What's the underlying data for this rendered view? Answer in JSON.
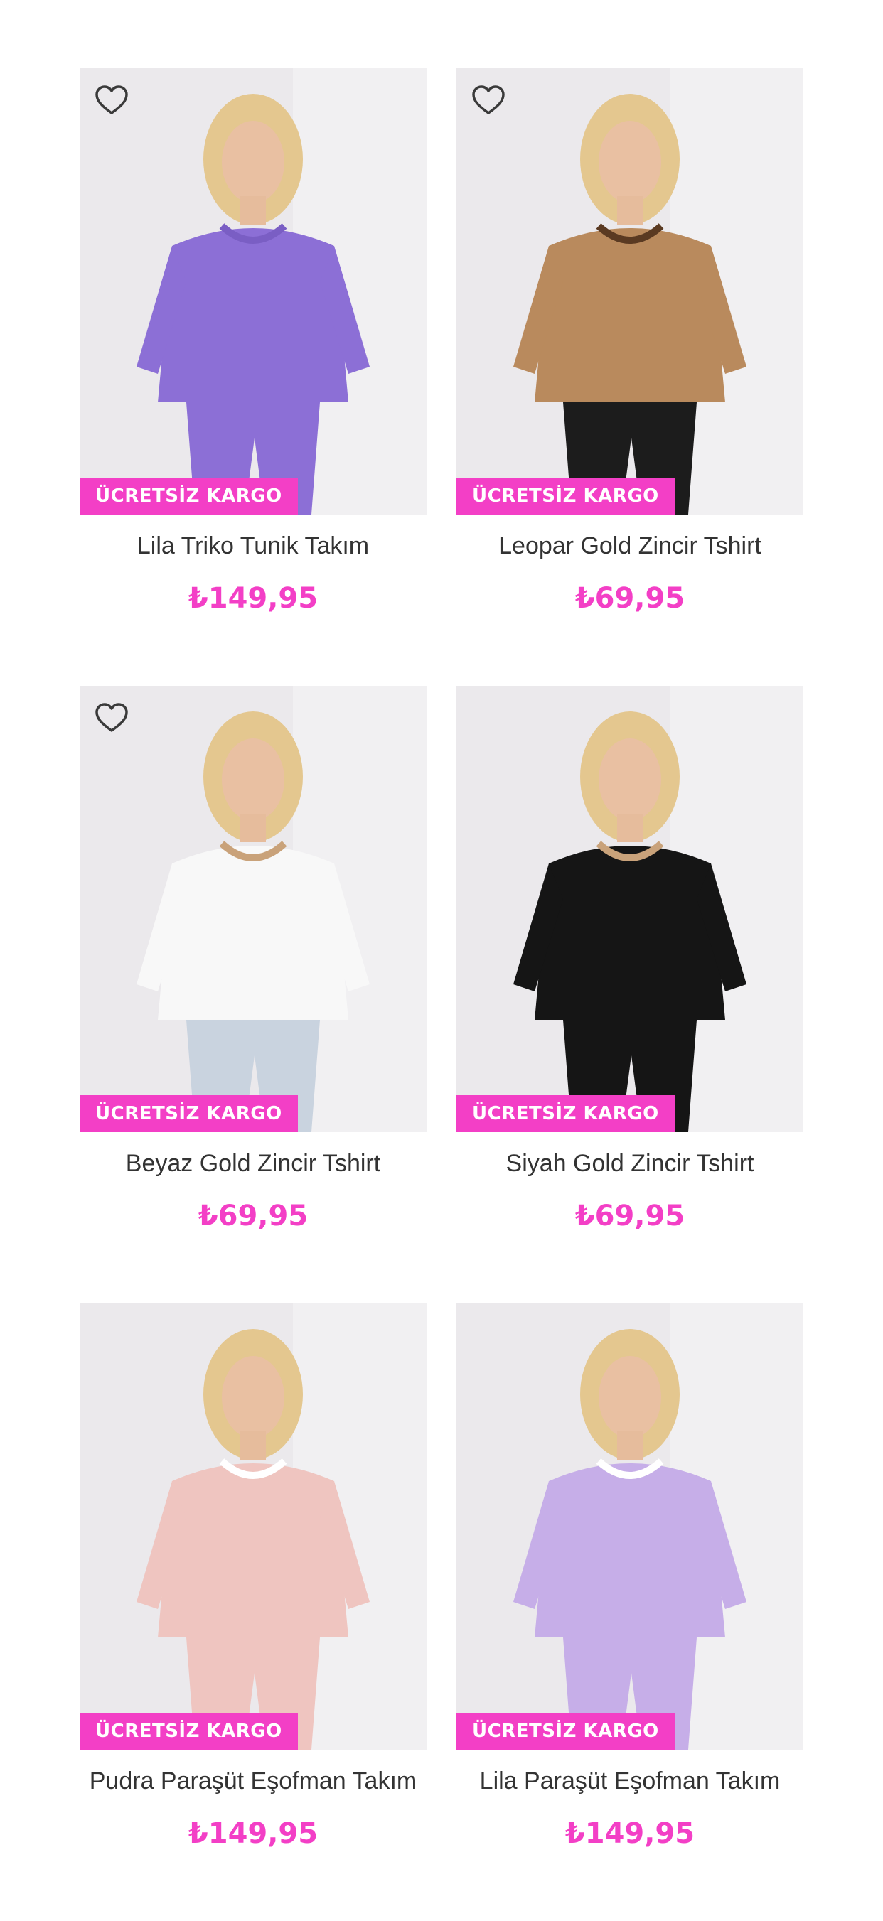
{
  "accent_color": "#f33fc6",
  "products": [
    {
      "name": "Lila Triko Tunik Takım",
      "price": "₺149,95",
      "badge": "ÜCRETSİZ KARGO",
      "favorite_icon": "heart-outline-icon",
      "has_favorite": true,
      "outfit_colors": {
        "top": "#8c6fd6",
        "bottom": "#8c6fd6",
        "accent": "#7a5ec4"
      }
    },
    {
      "name": "Leopar Gold Zincir Tshirt",
      "price": "₺69,95",
      "badge": "ÜCRETSİZ KARGO",
      "favorite_icon": "heart-outline-icon",
      "has_favorite": true,
      "outfit_colors": {
        "top": "#b98a5d",
        "bottom": "#1c1c1c",
        "accent": "#5a3a22"
      }
    },
    {
      "name": "Beyaz Gold Zincir Tshirt",
      "price": "₺69,95",
      "badge": "ÜCRETSİZ KARGO",
      "favorite_icon": "heart-outline-icon",
      "has_favorite": true,
      "outfit_colors": {
        "top": "#f8f8f8",
        "bottom": "#c9d3df",
        "accent": "#c9a27a"
      }
    },
    {
      "name": "Siyah Gold Zincir Tshirt",
      "price": "₺69,95",
      "badge": "ÜCRETSİZ KARGO",
      "favorite_icon": "",
      "has_favorite": false,
      "outfit_colors": {
        "top": "#151515",
        "bottom": "#151515",
        "accent": "#c9a27a"
      }
    },
    {
      "name": "Pudra Paraşüt Eşofman Takım",
      "price": "₺149,95",
      "badge": "ÜCRETSİZ KARGO",
      "favorite_icon": "",
      "has_favorite": false,
      "outfit_colors": {
        "top": "#efc5c0",
        "bottom": "#efc5c0",
        "accent": "#ffffff"
      }
    },
    {
      "name": "Lila Paraşüt Eşofman Takım",
      "price": "₺149,95",
      "badge": "ÜCRETSİZ KARGO",
      "favorite_icon": "",
      "has_favorite": false,
      "outfit_colors": {
        "top": "#c6aee8",
        "bottom": "#c6aee8",
        "accent": "#ffffff"
      }
    }
  ]
}
